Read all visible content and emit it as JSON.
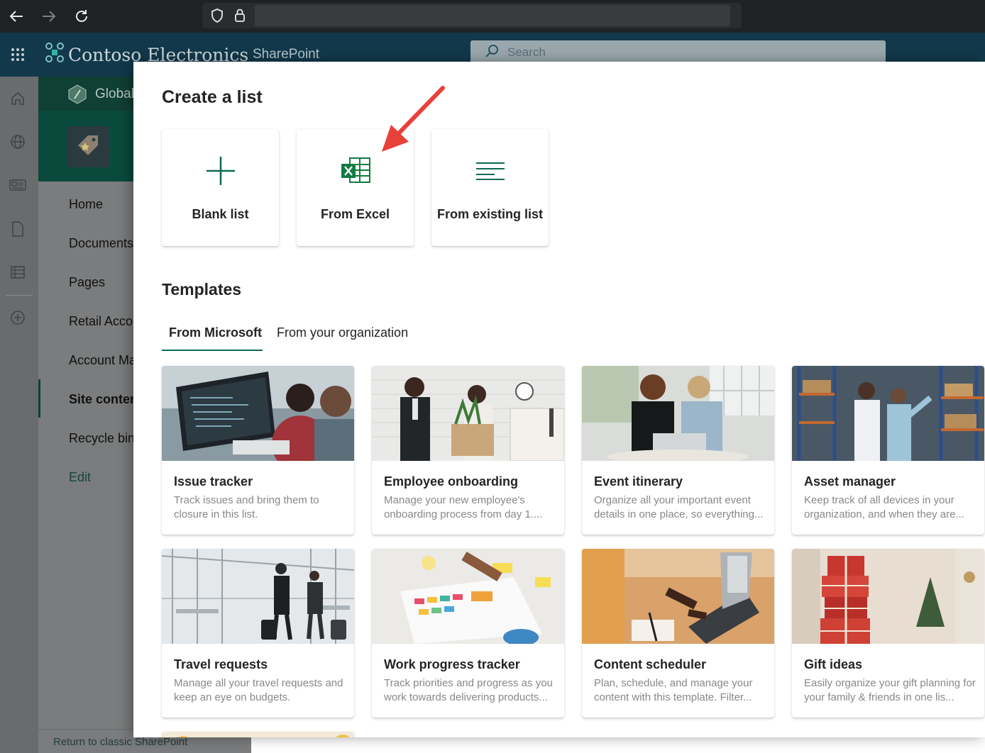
{
  "suite": {
    "brand": "Contoso Electronics",
    "app_name": "SharePoint",
    "search_placeholder": "Search"
  },
  "site": {
    "hub_name": "Global"
  },
  "nav": {
    "items": [
      {
        "label": "Home"
      },
      {
        "label": "Documents"
      },
      {
        "label": "Pages"
      },
      {
        "label": "Retail Accou"
      },
      {
        "label": "Account Ma"
      },
      {
        "label": "Site conten",
        "selected": true
      },
      {
        "label": "Recycle bin"
      }
    ],
    "edit_label": "Edit",
    "classic_link": "Return to classic SharePoint"
  },
  "panel": {
    "title": "Create a list",
    "create_options": [
      {
        "label": "Blank list",
        "icon": "plus-icon"
      },
      {
        "label": "From Excel",
        "icon": "excel-icon"
      },
      {
        "label": "From existing list",
        "icon": "list-lines-icon"
      }
    ],
    "templates_title": "Templates",
    "tabs": [
      {
        "label": "From Microsoft",
        "active": true
      },
      {
        "label": "From your organization",
        "active": false
      }
    ],
    "templates": [
      {
        "title": "Issue tracker",
        "desc": "Track issues and bring them to closure in this list."
      },
      {
        "title": "Employee onboarding",
        "desc": "Manage your new employee's onboarding process from day 1...."
      },
      {
        "title": "Event itinerary",
        "desc": "Organize all your important event details in one place, so everything..."
      },
      {
        "title": "Asset manager",
        "desc": "Keep track of all devices in your organization, and when they are..."
      },
      {
        "title": "Travel requests",
        "desc": "Manage all your travel requests and keep an eye on budgets."
      },
      {
        "title": "Work progress tracker",
        "desc": "Track priorities and progress as you work towards delivering products..."
      },
      {
        "title": "Content scheduler",
        "desc": "Plan, schedule, and manage your content with this template. Filter..."
      },
      {
        "title": "Gift ideas",
        "desc": "Easily organize your gift planning for your family & friends in one lis..."
      }
    ]
  },
  "colors": {
    "suite_bar": "#12394b",
    "accent": "#0b6a53",
    "excel_green": "#107c41",
    "annotation_arrow": "#e8413a"
  }
}
